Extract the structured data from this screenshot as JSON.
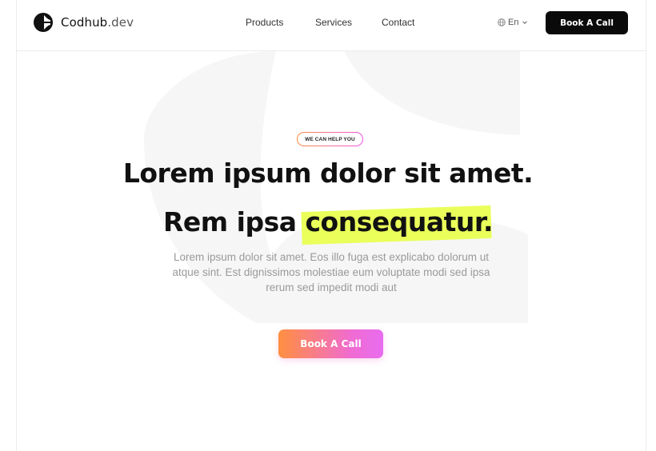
{
  "brand": {
    "name": "Codhub",
    "suffix": ".dev"
  },
  "nav": {
    "items": [
      {
        "label": "Products"
      },
      {
        "label": "Services"
      },
      {
        "label": "Contact"
      }
    ]
  },
  "language": {
    "label": "En"
  },
  "header": {
    "cta_label": "Book A Call"
  },
  "hero": {
    "badge": "WE CAN HELP YOU",
    "headline_line1": "Lorem ipsum dolor sit amet.",
    "headline_line2_prefix": "Rem ipsa ",
    "headline_line2_highlight": "consequatur.",
    "subtext": "Lorem ipsum dolor sit amet. Eos illo fuga est explicabo dolorum ut atque sint. Est dignissimos molestiae eum voluptate modi sed ipsa rerum sed impedit modi aut",
    "cta_label": "Book A Call"
  },
  "colors": {
    "accent_gradient_start": "#ff8f3f",
    "accent_gradient_end": "#e86cf0",
    "highlight": "#eaff5a",
    "header_button": "#0a0a0a"
  }
}
